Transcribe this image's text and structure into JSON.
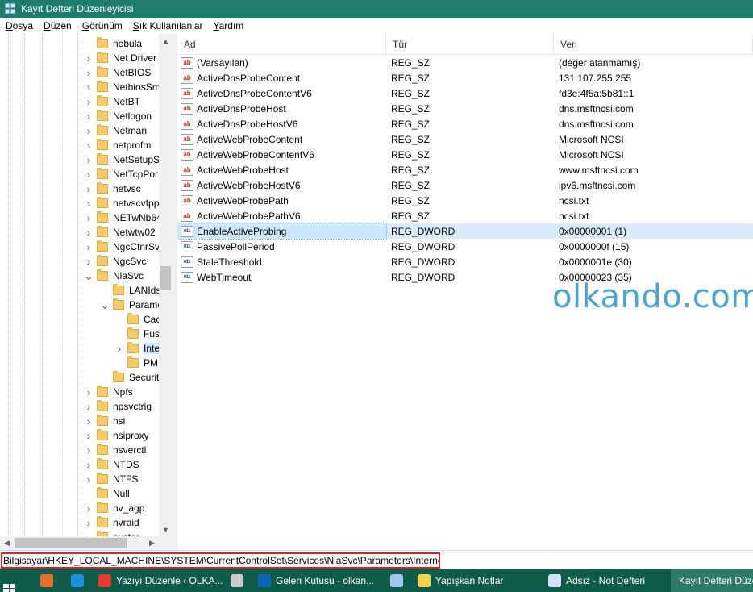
{
  "window": {
    "title": "Kayıt Defteri Düzenleyicisi"
  },
  "menu": [
    "Dosya",
    "Düzen",
    "Görünüm",
    "Sık Kullanılanlar",
    "Yardım"
  ],
  "menu_underline": [
    "D",
    "D",
    "G",
    "S",
    "Y"
  ],
  "tree": [
    {
      "label": "nebula",
      "level": 0,
      "expander": "none"
    },
    {
      "label": "Net Driver",
      "level": 0,
      "expander": "collapsed"
    },
    {
      "label": "NetBIOS",
      "level": 0,
      "expander": "collapsed"
    },
    {
      "label": "NetbiosSm",
      "level": 0,
      "expander": "collapsed"
    },
    {
      "label": "NetBT",
      "level": 0,
      "expander": "collapsed"
    },
    {
      "label": "Netlogon",
      "level": 0,
      "expander": "collapsed"
    },
    {
      "label": "Netman",
      "level": 0,
      "expander": "collapsed"
    },
    {
      "label": "netprofm",
      "level": 0,
      "expander": "collapsed"
    },
    {
      "label": "NetSetupSv",
      "level": 0,
      "expander": "collapsed"
    },
    {
      "label": "NetTcpPor",
      "level": 0,
      "expander": "collapsed"
    },
    {
      "label": "netvsc",
      "level": 0,
      "expander": "collapsed"
    },
    {
      "label": "netvscvfpp",
      "level": 0,
      "expander": "collapsed"
    },
    {
      "label": "NETwNb64",
      "level": 0,
      "expander": "collapsed"
    },
    {
      "label": "Netwtw02",
      "level": 0,
      "expander": "collapsed"
    },
    {
      "label": "NgcCtnrSv",
      "level": 0,
      "expander": "collapsed"
    },
    {
      "label": "NgcSvc",
      "level": 0,
      "expander": "collapsed"
    },
    {
      "label": "NlaSvc",
      "level": 0,
      "expander": "expanded"
    },
    {
      "label": "LANIds",
      "level": 1,
      "expander": "none"
    },
    {
      "label": "Parame",
      "level": 1,
      "expander": "expanded"
    },
    {
      "label": "Cac",
      "level": 2,
      "expander": "none"
    },
    {
      "label": "Fus",
      "level": 2,
      "expander": "none"
    },
    {
      "label": "Inte",
      "level": 2,
      "expander": "collapsed",
      "selected": true
    },
    {
      "label": "PM",
      "level": 2,
      "expander": "none"
    },
    {
      "label": "Security",
      "level": 1,
      "expander": "none"
    },
    {
      "label": "Npfs",
      "level": 0,
      "expander": "collapsed"
    },
    {
      "label": "npsvctrig",
      "level": 0,
      "expander": "collapsed"
    },
    {
      "label": "nsi",
      "level": 0,
      "expander": "collapsed"
    },
    {
      "label": "nsiproxy",
      "level": 0,
      "expander": "collapsed"
    },
    {
      "label": "nsverctl",
      "level": 0,
      "expander": "collapsed"
    },
    {
      "label": "NTDS",
      "level": 0,
      "expander": "collapsed"
    },
    {
      "label": "NTFS",
      "level": 0,
      "expander": "collapsed"
    },
    {
      "label": "Null",
      "level": 0,
      "expander": "none"
    },
    {
      "label": "nv_agp",
      "level": 0,
      "expander": "collapsed"
    },
    {
      "label": "nvraid",
      "level": 0,
      "expander": "collapsed"
    },
    {
      "label": "nvstor",
      "level": 0,
      "expander": "collapsed"
    }
  ],
  "list": {
    "headers": {
      "name": "Ad",
      "type": "Tür",
      "data": "Veri"
    },
    "rows": [
      {
        "icon": "sz",
        "name": "(Varsayılan)",
        "type": "REG_SZ",
        "data": "(değer atanmamış)"
      },
      {
        "icon": "sz",
        "name": "ActiveDnsProbeContent",
        "type": "REG_SZ",
        "data": "131.107.255.255"
      },
      {
        "icon": "sz",
        "name": "ActiveDnsProbeContentV6",
        "type": "REG_SZ",
        "data": "fd3e:4f5a:5b81::1"
      },
      {
        "icon": "sz",
        "name": "ActiveDnsProbeHost",
        "type": "REG_SZ",
        "data": "dns.msftncsi.com"
      },
      {
        "icon": "sz",
        "name": "ActiveDnsProbeHostV6",
        "type": "REG_SZ",
        "data": "dns.msftncsi.com"
      },
      {
        "icon": "sz",
        "name": "ActiveWebProbeContent",
        "type": "REG_SZ",
        "data": "Microsoft NCSI"
      },
      {
        "icon": "sz",
        "name": "ActiveWebProbeContentV6",
        "type": "REG_SZ",
        "data": "Microsoft NCSI"
      },
      {
        "icon": "sz",
        "name": "ActiveWebProbeHost",
        "type": "REG_SZ",
        "data": "www.msftncsi.com"
      },
      {
        "icon": "sz",
        "name": "ActiveWebProbeHostV6",
        "type": "REG_SZ",
        "data": "ipv6.msftncsi.com"
      },
      {
        "icon": "sz",
        "name": "ActiveWebProbePath",
        "type": "REG_SZ",
        "data": "ncsi.txt"
      },
      {
        "icon": "sz",
        "name": "ActiveWebProbePathV6",
        "type": "REG_SZ",
        "data": "ncsi.txt"
      },
      {
        "icon": "dword",
        "name": "EnableActiveProbing",
        "type": "REG_DWORD",
        "data": "0x00000001 (1)",
        "selected": true
      },
      {
        "icon": "dword",
        "name": "PassivePollPeriod",
        "type": "REG_DWORD",
        "data": "0x0000000f (15)"
      },
      {
        "icon": "dword",
        "name": "StaleThreshold",
        "type": "REG_DWORD",
        "data": "0x0000001e (30)"
      },
      {
        "icon": "dword",
        "name": "WebTimeout",
        "type": "REG_DWORD",
        "data": "0x00000023 (35)"
      }
    ]
  },
  "icons": {
    "sz": "ab",
    "dword": "011"
  },
  "watermark": "olkando.com",
  "status": {
    "path": "Bilgisayar\\HKEY_LOCAL_MACHINE\\SYSTEM\\CurrentControlSet\\Services\\NlaSvc\\Parameters\\Internet"
  },
  "taskbar": {
    "items": [
      {
        "label": "",
        "icon": "firefox-icon",
        "color": "#e8702a"
      },
      {
        "label": "",
        "icon": "ie-icon",
        "color": "#1f8ee0"
      },
      {
        "label": "Yazıyı Düzenle ‹ OLKA...",
        "icon": "chrome-icon",
        "color": "#e33b2e"
      },
      {
        "label": "",
        "icon": "settings-app-icon",
        "color": "#c9c9c9"
      },
      {
        "label": "Gelen Kutusu - olkan...",
        "icon": "outlook-icon",
        "color": "#0a64b4"
      },
      {
        "label": "",
        "icon": "network-icon",
        "color": "#9ec8ef"
      },
      {
        "label": "Yapışkan Notlar",
        "icon": "sticky-notes-icon",
        "color": "#f4d34b"
      },
      {
        "label": "Adsız - Not Defteri",
        "icon": "notepad-icon",
        "color": "#cfe3f7"
      },
      {
        "label": "Kayıt Defteri Düzen...",
        "icon": "regedit-icon",
        "color": "#62a7e8",
        "active": true
      }
    ]
  }
}
